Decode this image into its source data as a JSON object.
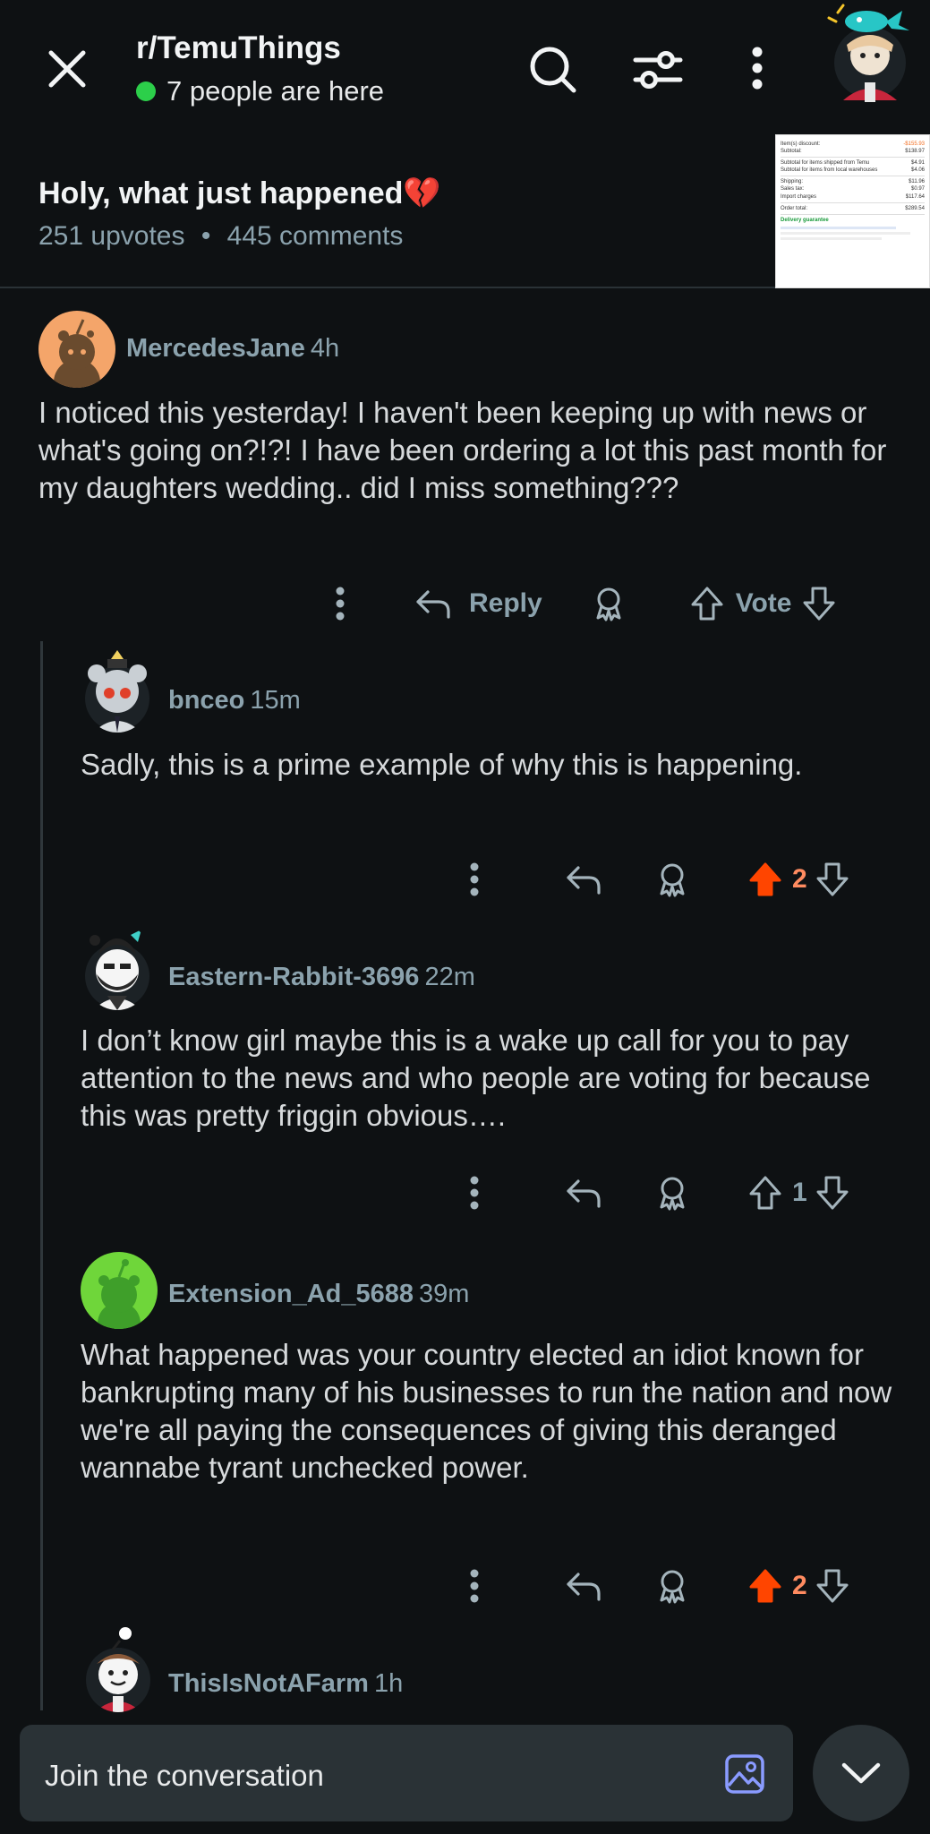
{
  "header": {
    "subreddit": "r/TemuThings",
    "online_text": "7 people are here",
    "close_icon": "close-icon",
    "search_icon": "search-icon",
    "filter_icon": "sort-filter-icon",
    "more_icon": "more-vertical-icon"
  },
  "post": {
    "title": "Holy, what just happened💔",
    "upvotes": "251 upvotes",
    "separator": "•",
    "comments": "445 comments",
    "thumbnail": {
      "rows": [
        [
          "Item(s) discount:",
          "-$155.93"
        ],
        [
          "Subtotal:",
          "$138.97"
        ],
        [
          "Subtotal for items shipped from Temu",
          "$4.91"
        ],
        [
          "Subtotal for items from local warehouses",
          "$4.06"
        ],
        [
          "Shipping:",
          "$11.96"
        ],
        [
          "Sales tax:",
          "$0.97"
        ],
        [
          "Import charges",
          "$117.64"
        ],
        [
          "Order total:",
          "$289.54"
        ]
      ],
      "guarantee": "Delivery guarantee"
    }
  },
  "comments": [
    {
      "user": "MercedesJane",
      "time": "4h",
      "text": "I noticed this yesterday! I haven't been keeping up with news or what's going on?!?! I have been ordering a lot this past month for my daughters wedding.. did I miss something???",
      "reply_label": "Reply",
      "vote_label": "Vote"
    },
    {
      "user": "bnceo",
      "time": "15m",
      "text": "Sadly, this is a prime example of why this is happening.",
      "votes": "2",
      "upvoted": true
    },
    {
      "user": "Eastern-Rabbit-3696",
      "time": "22m",
      "text": "I don’t know girl maybe this is a wake up call for you to pay attention to the news and who people are voting for because this was pretty friggin obvious….",
      "votes": "1",
      "upvoted": false
    },
    {
      "user": "Extension_Ad_5688",
      "time": "39m",
      "text": "What happened was your country elected an idiot known for bankrupting many of his businesses to run the nation and now we're all paying the consequences of giving this deranged wannabe tyrant unchecked power.",
      "votes": "2",
      "upvoted": true
    },
    {
      "user": "ThisIsNotAFarm",
      "time": "1h"
    }
  ],
  "composer": {
    "placeholder": "Join the conversation",
    "image_icon": "image-icon",
    "scroll_icon": "chevron-down-icon"
  },
  "colors": {
    "background": "#0e1113",
    "upvote_active": "#ff4500",
    "vote_count_active": "#ff8b60",
    "muted": "#8ba2ad",
    "online": "#2ccf4a",
    "image_icon": "#8a9bff"
  }
}
